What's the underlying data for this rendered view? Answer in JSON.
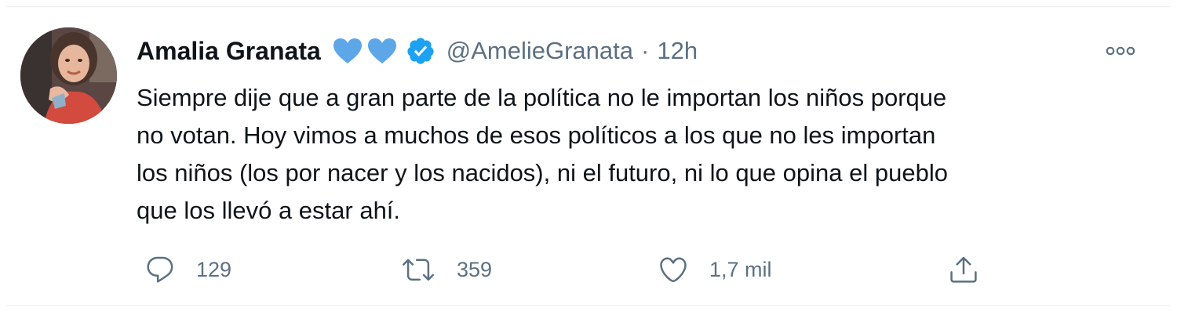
{
  "tweet": {
    "author_name": "Amalia Granata",
    "handle": "@AmelieGranata",
    "separator": "·",
    "time": "12h",
    "text": "Siempre dije que a gran parte de la política no le importan los niños porque\nno votan. Hoy vimos a muchos de esos políticos a los que no les importan\nlos niños (los por nacer y los nacidos), ni el futuro, ni lo que opina el pueblo\nque los llevó a estar ahí.",
    "badges": [
      "blue-heart-icon",
      "blue-heart-icon",
      "verified-badge-icon"
    ],
    "more_icon": "more-options-icon"
  },
  "actions": {
    "reply": {
      "icon": "reply-icon",
      "count": "129"
    },
    "retweet": {
      "icon": "retweet-icon",
      "count": "359"
    },
    "like": {
      "icon": "heart-icon",
      "count": "1,7 mil"
    },
    "share": {
      "icon": "share-icon"
    }
  },
  "colors": {
    "text_primary": "#0f1419",
    "text_secondary": "#5b7083",
    "heart_blue": "#5da6e8",
    "verified_blue": "#1da1f2",
    "icon_gray": "#5b7083"
  }
}
